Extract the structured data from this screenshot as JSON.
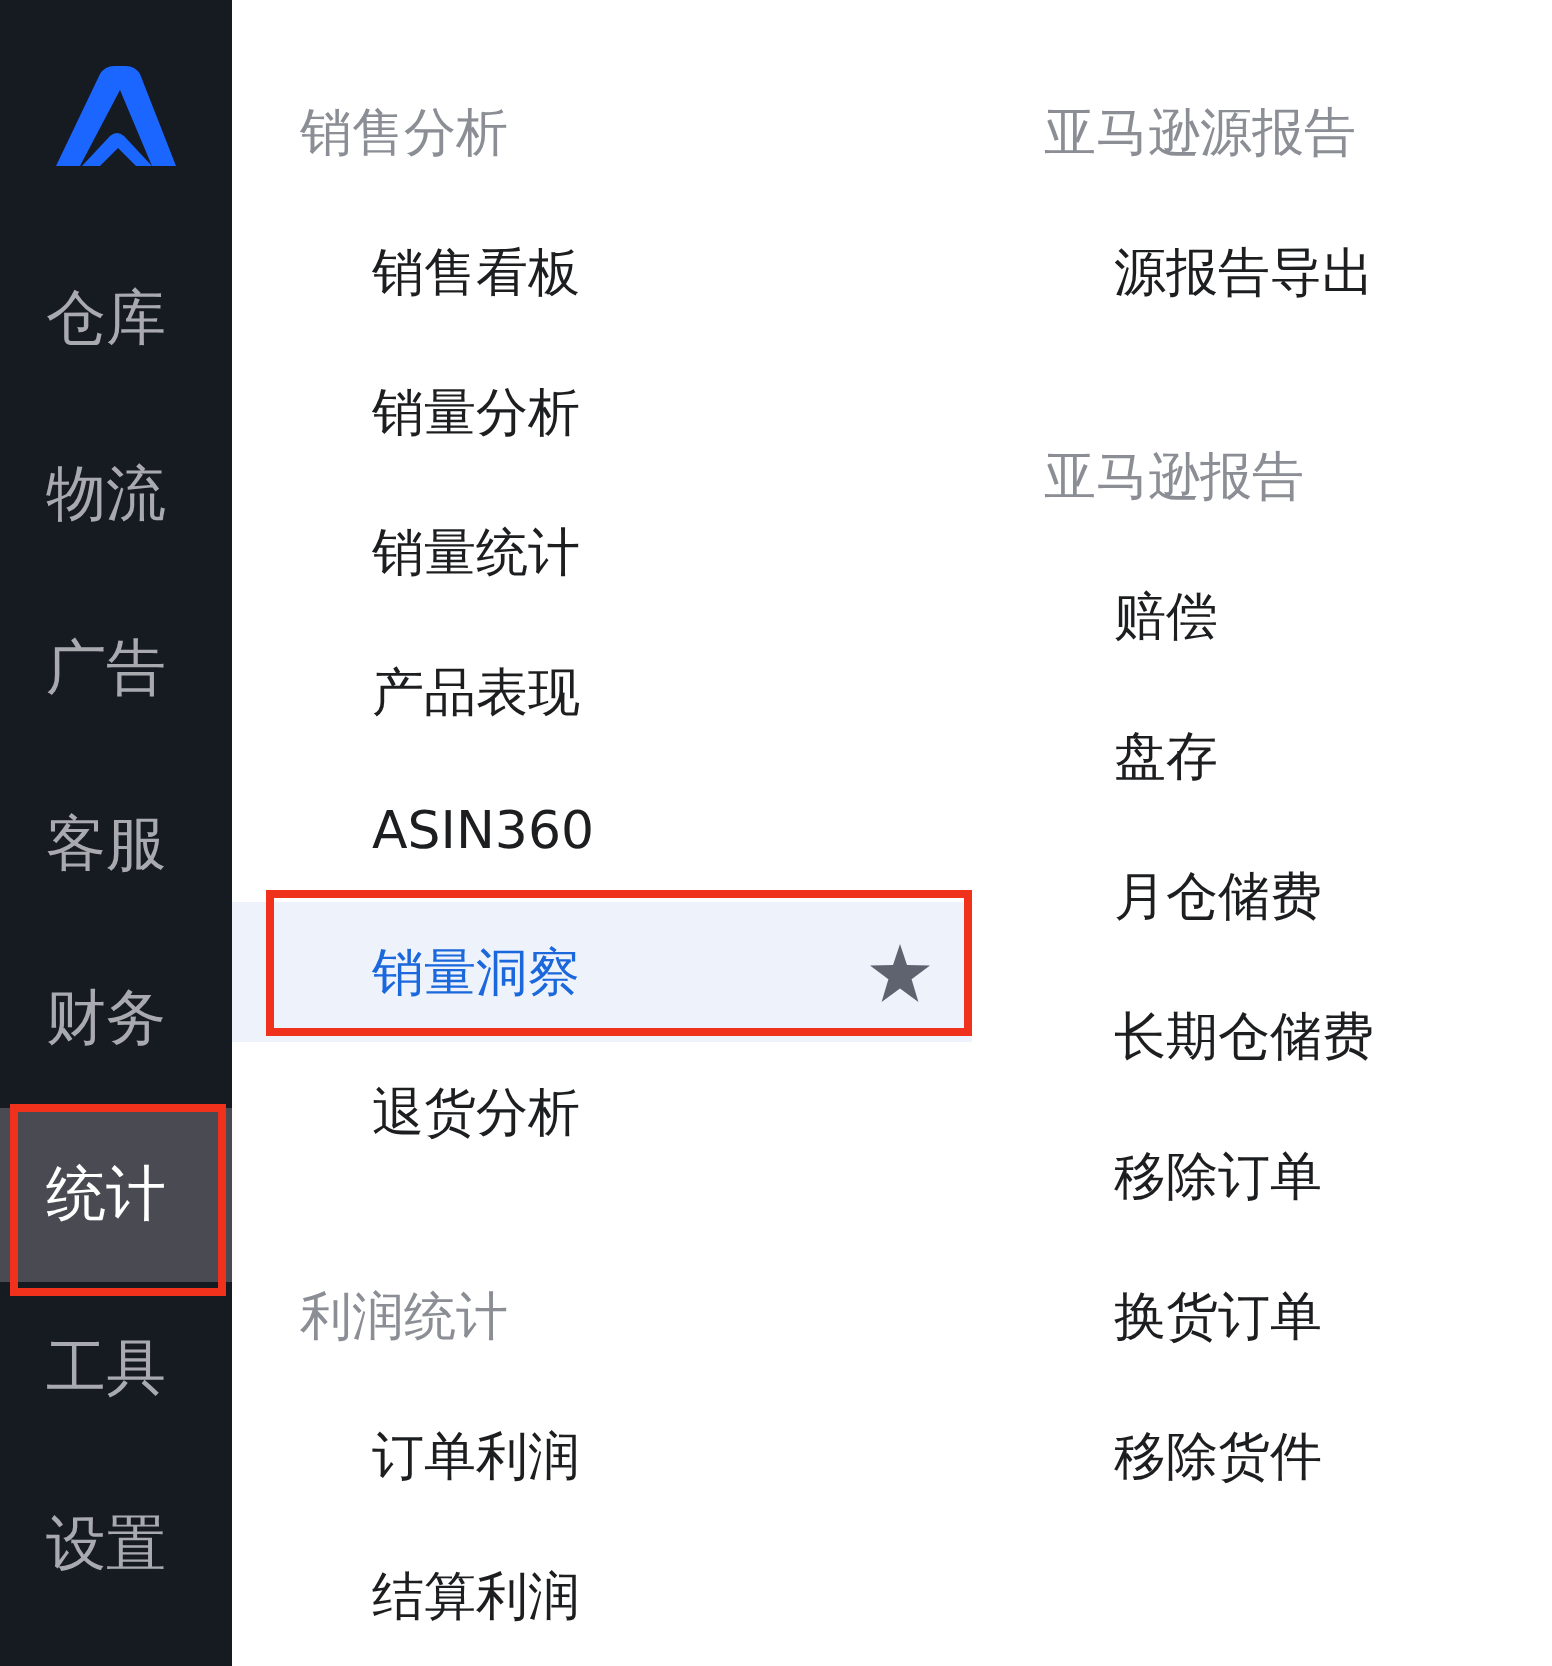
{
  "sidebar": {
    "items": [
      {
        "label": "仓库",
        "selected": false,
        "highlighted": false
      },
      {
        "label": "物流",
        "selected": false,
        "highlighted": false
      },
      {
        "label": "广告",
        "selected": false,
        "highlighted": false
      },
      {
        "label": "客服",
        "selected": false,
        "highlighted": false
      },
      {
        "label": "财务",
        "selected": false,
        "highlighted": false
      },
      {
        "label": "统计",
        "selected": true,
        "highlighted": true
      },
      {
        "label": "工具",
        "selected": false,
        "highlighted": false
      },
      {
        "label": "设置",
        "selected": false,
        "highlighted": false
      }
    ]
  },
  "menu": {
    "columns": [
      {
        "groups": [
          {
            "title": "销售分析",
            "items": [
              {
                "label": "销售看板",
                "selected": false,
                "starred": false,
                "highlighted": false
              },
              {
                "label": "销量分析",
                "selected": false,
                "starred": false,
                "highlighted": false
              },
              {
                "label": "销量统计",
                "selected": false,
                "starred": false,
                "highlighted": false
              },
              {
                "label": "产品表现",
                "selected": false,
                "starred": false,
                "highlighted": false
              },
              {
                "label": "ASIN360",
                "selected": false,
                "starred": false,
                "highlighted": false
              },
              {
                "label": "销量洞察",
                "selected": true,
                "starred": true,
                "highlighted": true
              },
              {
                "label": "退货分析",
                "selected": false,
                "starred": false,
                "highlighted": false
              }
            ]
          },
          {
            "title": "利润统计",
            "items": [
              {
                "label": "订单利润",
                "selected": false,
                "starred": false,
                "highlighted": false
              },
              {
                "label": "结算利润",
                "selected": false,
                "starred": false,
                "highlighted": false
              }
            ]
          }
        ]
      },
      {
        "groups": [
          {
            "title": "亚马逊源报告",
            "items": [
              {
                "label": "源报告导出",
                "selected": false,
                "starred": false,
                "highlighted": false
              }
            ]
          },
          {
            "title": "亚马逊报告",
            "items": [
              {
                "label": "赔偿",
                "selected": false,
                "starred": false,
                "highlighted": false
              },
              {
                "label": "盘存",
                "selected": false,
                "starred": false,
                "highlighted": false
              },
              {
                "label": "月仓储费",
                "selected": false,
                "starred": false,
                "highlighted": false
              },
              {
                "label": "长期仓储费",
                "selected": false,
                "starred": false,
                "highlighted": false
              },
              {
                "label": "移除订单",
                "selected": false,
                "starred": false,
                "highlighted": false
              },
              {
                "label": "换货订单",
                "selected": false,
                "starred": false,
                "highlighted": false
              },
              {
                "label": "移除货件",
                "selected": false,
                "starred": false,
                "highlighted": false
              }
            ]
          }
        ]
      }
    ]
  }
}
